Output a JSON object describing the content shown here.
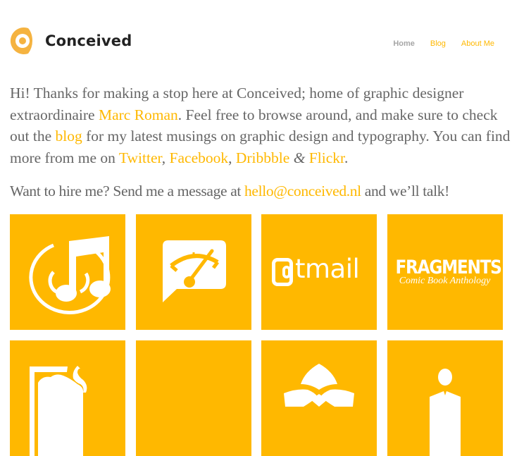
{
  "header": {
    "site_name": "Conceived",
    "logo_icon": "conceived-logo-icon",
    "nav": [
      {
        "label": "Home",
        "active": true
      },
      {
        "label": "Blog",
        "active": false
      },
      {
        "label": "About Me",
        "active": false
      }
    ]
  },
  "intro": {
    "t1": "Hi! Thanks for making a stop here at Conceived; home of graphic designer extraordinaire ",
    "link_name": "Marc Roman",
    "t2": ". Feel free to browse around, and make sure to check out the ",
    "link_blog": "blog",
    "t3": " for my latest musings on graphic design and typography. You can find more from me on ",
    "link_twitter": "Twitter",
    "sep1": ", ",
    "link_facebook": "Facebook",
    "sep2": ", ",
    "link_dribbble": "Dribbble",
    "amp": " & ",
    "link_flickr": "Flickr",
    "end": "."
  },
  "hire": {
    "t1": "Want to hire me? Send me a message at ",
    "email": "hello@conceived.nl",
    "t2": " and we’ll talk!"
  },
  "portfolio": {
    "tiles": [
      {
        "icon": "music-note-icon"
      },
      {
        "icon": "speech-bubble-gauge-icon"
      },
      {
        "icon": "atmail-logo",
        "text": "tmail"
      },
      {
        "icon": "fragments-logo",
        "title": "FRAGMENTS",
        "subtitle": "Comic Book Anthology"
      },
      {
        "icon": "framed-elephant-icon"
      },
      {
        "icon": "blank-tile"
      },
      {
        "icon": "lotus-icon"
      },
      {
        "icon": "person-icon"
      }
    ]
  },
  "colors": {
    "accent": "#ffb800",
    "text": "#666666",
    "logo_text": "#222222",
    "nav_active": "#a6a6a6"
  }
}
